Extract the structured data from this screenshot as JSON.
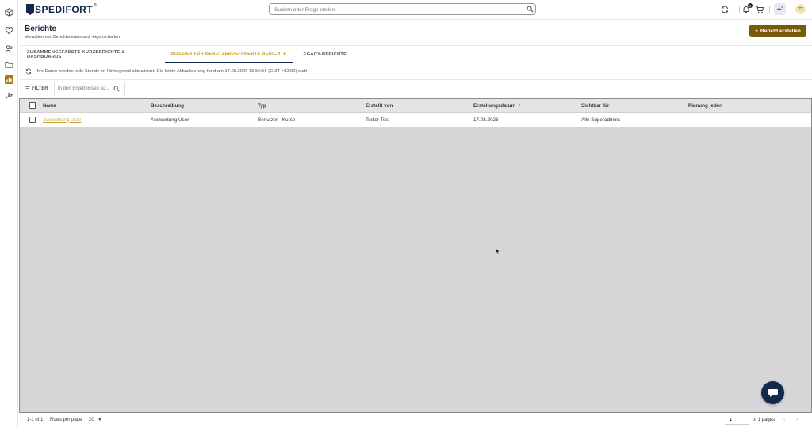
{
  "app": {
    "logo_text": "SPEDIFORT",
    "logo_mark": "®"
  },
  "search": {
    "placeholder": "Suchen oder Frage stellen"
  },
  "topbar": {
    "notification_count": "3",
    "avatar_initials": "TT"
  },
  "page": {
    "title": "Berichte",
    "subtitle": "Verwalten von Berichtsdetails und -eigenschaften",
    "create_button": "Bericht erstellen",
    "create_icon": "+"
  },
  "tabs": [
    {
      "label": "ZUSAMMENGEFASSTE KURZBERICHTE & DASHBOARDS",
      "active": false
    },
    {
      "label": "BUILDER FÜR BENUTZERDEFINIERTE BERICHTE",
      "active": true
    },
    {
      "label": "LEGACY-BERICHTE",
      "active": false
    }
  ],
  "info": {
    "text": "Ihre Daten werden jede Stunde im Hintergrund aktualisiert. Die letzte Aktualisierung fand am 17.08.2026 15:50:56 (GMT +02:00) statt"
  },
  "filter": {
    "label": "FILTER",
    "placeholder": "In den Ergebnissen su..."
  },
  "table": {
    "columns": [
      "Name",
      "Beschreibung",
      "Typ",
      "Erstellt von",
      "Erstellungsdatum",
      "Sichtbar für",
      "Planung jeden"
    ],
    "sort_indicator": "↓",
    "rows": [
      {
        "name": "Auswertung User",
        "beschreibung": "Auswertung User",
        "typ": "Benutzer - Kurse",
        "erstellt_von": "Tester Test",
        "datum": "17.08.2026",
        "sichtbar": "Alle Superadmins",
        "planung": ""
      }
    ]
  },
  "pager": {
    "range": "1-1 of 1",
    "rows_label": "Rows per page",
    "rows_value": "20",
    "page_value": "1",
    "of_pages": "of 1 pages",
    "prev": "‹",
    "next": "›"
  },
  "colors": {
    "brand_navy": "#13294b",
    "accent_gold": "#c8a030",
    "button_brown": "#7a5a0a"
  }
}
